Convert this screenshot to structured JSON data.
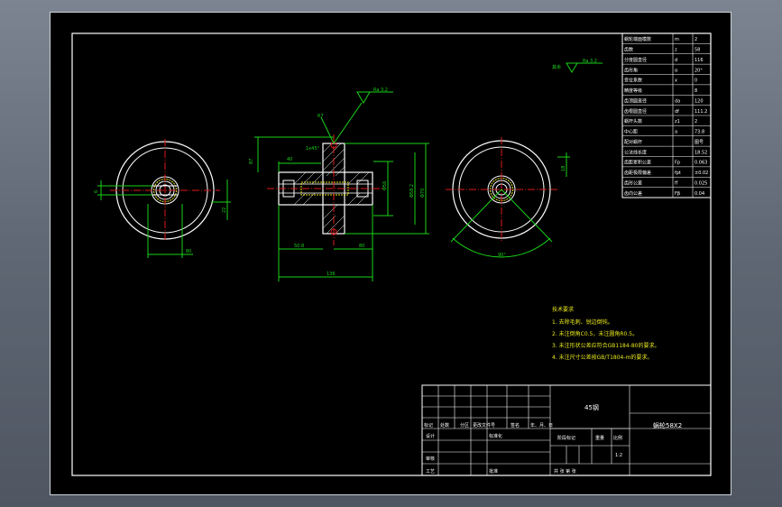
{
  "surface_roughness": {
    "top": "Ra 3.2",
    "main": "Ra 3.2",
    "other_label": "其余"
  },
  "dimensions": {
    "d_left_a": "6",
    "d_left_b": "22",
    "d_left_c": "80",
    "d_flange": "87",
    "d_small": "40",
    "d_dia1": "Φ70",
    "d_dia2": "Φ58.2",
    "d_dia3": "Φ56",
    "d_len1": "50.8",
    "d_len2": "80",
    "d_len3": "136",
    "d_taper": "1x45°",
    "d_right_a": "18",
    "angle": "90°",
    "d_chamfer": "R7"
  },
  "spec_table": [
    [
      "蜗轮端面模数",
      "m",
      "2"
    ],
    [
      "齿数",
      "z",
      "58"
    ],
    [
      "分度圆直径",
      "d",
      "116"
    ],
    [
      "齿形角",
      "α",
      "20°"
    ],
    [
      "变位系数",
      "x",
      "0"
    ],
    [
      "精度等级",
      "",
      "8"
    ],
    [
      "齿顶圆直径",
      "da",
      "120"
    ],
    [
      "齿根圆直径",
      "df",
      "111.2"
    ],
    [
      "蜗杆头数",
      "z1",
      "2"
    ],
    [
      "中心距",
      "a",
      "73.8"
    ],
    [
      "配对蜗杆",
      "",
      "图号"
    ],
    [
      "公法线长度",
      "",
      "18.52"
    ],
    [
      "齿距累积公差",
      "Fp",
      "0.063"
    ],
    [
      "齿距极限偏差",
      "fpt",
      "±0.02"
    ],
    [
      "齿形公差",
      "ff",
      "0.025"
    ],
    [
      "齿向公差",
      "Fβ",
      "0.04"
    ]
  ],
  "tech_requirements": {
    "title": "技术要求",
    "items": [
      "1. 去除毛刺、锐边倒钝。",
      "2. 未注倒角C0.5，未注圆角R0.5。",
      "3. 未注形状公差应符合GB1184-80的要求。",
      "4. 未注尺寸公差按GB/T1804-m的要求。"
    ]
  },
  "title_block": {
    "material": "45钢",
    "drawing_name": "蜗轮58X2",
    "row_headers": [
      "标记",
      "处数",
      "分区",
      "更改文件号",
      "签名",
      "年、月、日"
    ],
    "design": "设计",
    "standardization": "标准化",
    "stage_mark": "阶段标记",
    "weight": "重量",
    "scale_label": "比例",
    "scale": "1:2",
    "check": "审核",
    "process": "工艺",
    "approve": "批准",
    "sheet_info": "共   张   第   张"
  }
}
